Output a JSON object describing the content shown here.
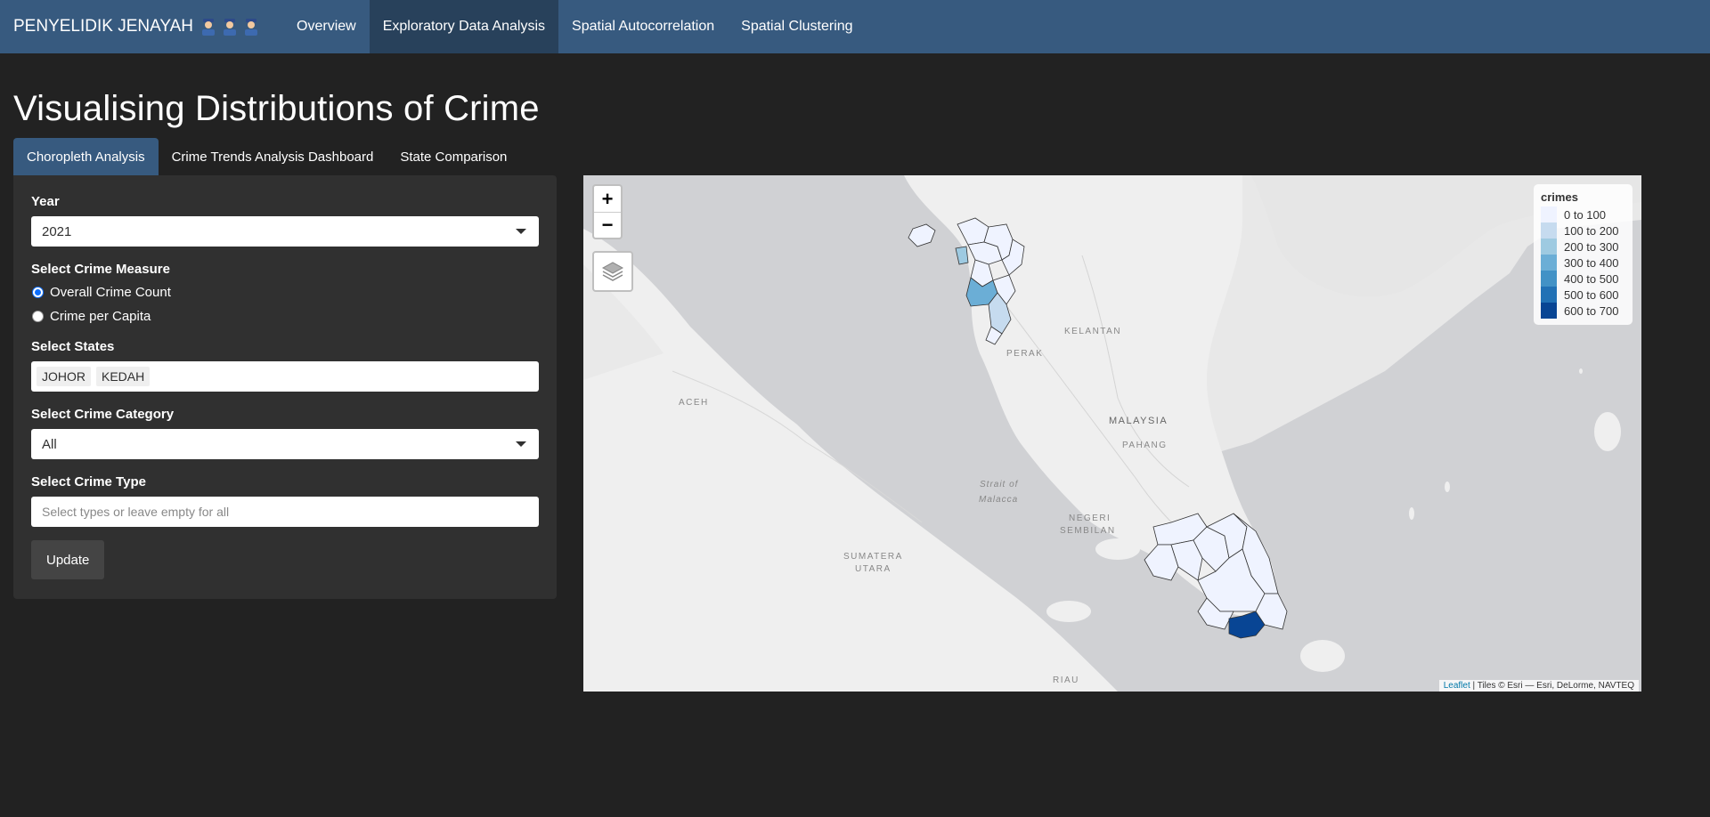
{
  "navbar": {
    "brand": "PENYELIDIK JENAYAH",
    "brand_icons": [
      "police-officer-icon",
      "police-officer-icon",
      "police-officer-icon"
    ],
    "items": [
      {
        "label": "Overview",
        "active": false
      },
      {
        "label": "Exploratory Data Analysis",
        "active": true
      },
      {
        "label": "Spatial Autocorrelation",
        "active": false
      },
      {
        "label": "Spatial Clustering",
        "active": false
      }
    ]
  },
  "page_title": "Visualising Distributions of Crime",
  "tabs": [
    {
      "label": "Choropleth Analysis",
      "active": true
    },
    {
      "label": "Crime Trends Analysis Dashboard",
      "active": false
    },
    {
      "label": "State Comparison",
      "active": false
    }
  ],
  "sidebar": {
    "year": {
      "label": "Year",
      "value": "2021"
    },
    "measure": {
      "label": "Select Crime Measure",
      "options": [
        "Overall Crime Count",
        "Crime per Capita"
      ],
      "selected": "Overall Crime Count"
    },
    "states": {
      "label": "Select States",
      "selected": [
        "JOHOR",
        "KEDAH"
      ]
    },
    "category": {
      "label": "Select Crime Category",
      "value": "All"
    },
    "crime_type": {
      "label": "Select Crime Type",
      "placeholder": "Select types or leave empty for all"
    },
    "update_button": "Update"
  },
  "map": {
    "zoom_in": "+",
    "zoom_out": "−",
    "legend": {
      "title": "crimes",
      "items": [
        {
          "label": "0 to 100",
          "color": "#eff3ff"
        },
        {
          "label": "100 to 200",
          "color": "#c6dbef"
        },
        {
          "label": "200 to 300",
          "color": "#9ecae1"
        },
        {
          "label": "300 to 400",
          "color": "#6baed6"
        },
        {
          "label": "400 to 500",
          "color": "#4292c6"
        },
        {
          "label": "500 to 600",
          "color": "#2171b5"
        },
        {
          "label": "600 to 700",
          "color": "#084594"
        }
      ]
    },
    "labels": {
      "kelantan": "KELANTAN",
      "perak": "PERAK",
      "aceh": "ACEH",
      "malaysia": "MALAYSIA",
      "pahang": "PAHANG",
      "strait_1": "Strait of",
      "strait_2": "Malacca",
      "negeri_1": "NEGERI",
      "negeri_2": "SEMBILAN",
      "sumatera_1": "SUMATERA",
      "sumatera_2": "UTARA",
      "riau": "RIAU"
    },
    "attribution": {
      "link": "Leaflet",
      "text": " | Tiles © Esri — Esri, DeLorme, NAVTEQ"
    }
  }
}
